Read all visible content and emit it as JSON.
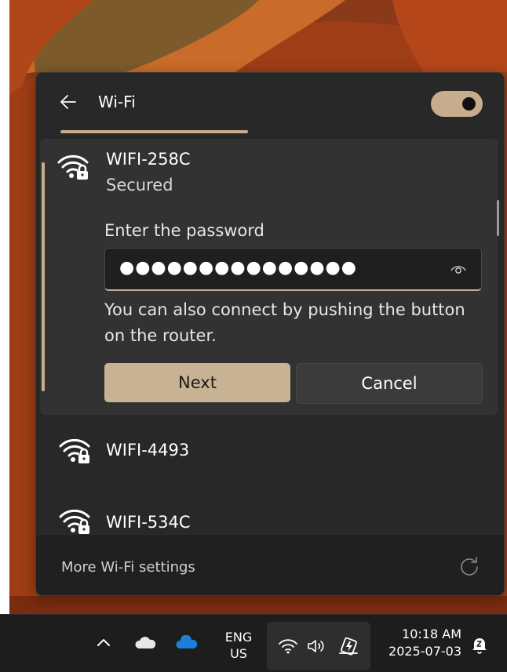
{
  "wifi_panel": {
    "title": "Wi-Fi",
    "wifi_enabled": true,
    "scan_progress": 0.5,
    "expanded_network": {
      "name": "WIFI-258C",
      "security_status": "Secured",
      "password_label": "Enter the password",
      "password_value": "●●●●●●●●●●●●●●●",
      "wps_hint": "You can also connect by pushing the button on the router.",
      "next_label": "Next",
      "cancel_label": "Cancel"
    },
    "networks": [
      {
        "name": "WIFI-4493"
      },
      {
        "name": "WIFI-534C"
      }
    ],
    "footer_link": "More Wi-Fi settings"
  },
  "taskbar": {
    "language": "ENG",
    "region": "US",
    "time": "10:18 AM",
    "date": "2025-07-03"
  },
  "colors": {
    "accent": "#c8ad8c",
    "wallpaper_orange": "#a8451c",
    "flyout_bg": "#282828"
  },
  "icons": {
    "back": "back-arrow-icon",
    "wifi_secured": "wifi-lock-icon",
    "reveal_password": "eye-icon",
    "refresh": "refresh-icon",
    "tray_overflow": "chevron-up-icon",
    "onedrive_personal": "cloud-white-icon",
    "onedrive_business": "cloud-blue-icon",
    "wifi": "wifi-icon",
    "volume": "speaker-icon",
    "battery": "battery-charging-icon",
    "notifications": "notification-bell-icon"
  }
}
